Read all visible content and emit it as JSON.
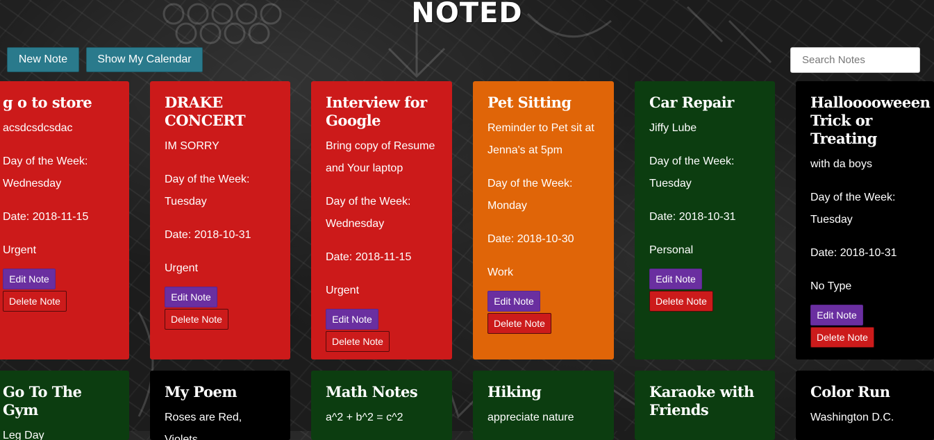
{
  "app": {
    "title": "NOTED"
  },
  "toolbar": {
    "new_note": "New Note",
    "show_calendar": "Show My Calendar"
  },
  "search": {
    "placeholder": "Search Notes"
  },
  "colors": {
    "red": "#cc1a1a",
    "orange": "#e06508",
    "green": "#0c3d10",
    "black": "#000000",
    "edit": "#6a2fa0",
    "toolbar_button": "#2a7a8c"
  },
  "notes_row1": [
    {
      "title": "g o to store",
      "body": "acsdcsdcsdac",
      "day_label": "Day of the Week:",
      "day": "Wednesday",
      "date": "Date: 2018-11-15",
      "type": "Urgent",
      "edit": "Edit Note",
      "delete": "Delete Note",
      "color": "red"
    },
    {
      "title": "DRAKE CONCERT",
      "body": "IM SORRY",
      "day_label": "Day of the Week:",
      "day": "Tuesday",
      "date": "Date: 2018-10-31",
      "type": "Urgent",
      "edit": "Edit Note",
      "delete": "Delete Note",
      "color": "red"
    },
    {
      "title": "Interview for Google",
      "body": "Bring copy of Resume and Your laptop",
      "day_label": "Day of the Week:",
      "day": "Wednesday",
      "date": "Date: 2018-11-15",
      "type": "Urgent",
      "edit": "Edit Note",
      "delete": "Delete Note",
      "color": "red"
    },
    {
      "title": "Pet Sitting",
      "body": "Reminder to Pet sit at Jenna's at 5pm",
      "day_label": "Day of the Week:",
      "day": "Monday",
      "date": "Date: 2018-10-30",
      "type": "Work",
      "edit": "Edit Note",
      "delete": "Delete Note",
      "color": "orange"
    },
    {
      "title": "Car Repair",
      "body": "Jiffy Lube",
      "day_label": "Day of the Week:",
      "day": "Tuesday",
      "date": "Date: 2018-10-31",
      "type": "Personal",
      "edit": "Edit Note",
      "delete": "Delete Note",
      "color": "green"
    },
    {
      "title": "Hallooooweeen Trick or Treating",
      "body": "with da boys",
      "day_label": "Day of the Week:",
      "day": "Tuesday",
      "date": "Date: 2018-10-31",
      "type": "No Type",
      "edit": "Edit Note",
      "delete": "Delete Note",
      "color": "black"
    }
  ],
  "notes_row2": [
    {
      "title": "Go To The Gym",
      "body": "Leg Day",
      "color": "green"
    },
    {
      "title": "My Poem",
      "body": "Roses are Red, Violets",
      "color": "black"
    },
    {
      "title": "Math Notes",
      "body": "a^2 + b^2 = c^2",
      "color": "green"
    },
    {
      "title": "Hiking",
      "body": "appreciate nature",
      "color": "green"
    },
    {
      "title": "Karaoke with Friends",
      "body": "",
      "color": "green"
    },
    {
      "title": "Color Run",
      "body": "Washington D.C.",
      "color": "black"
    }
  ]
}
